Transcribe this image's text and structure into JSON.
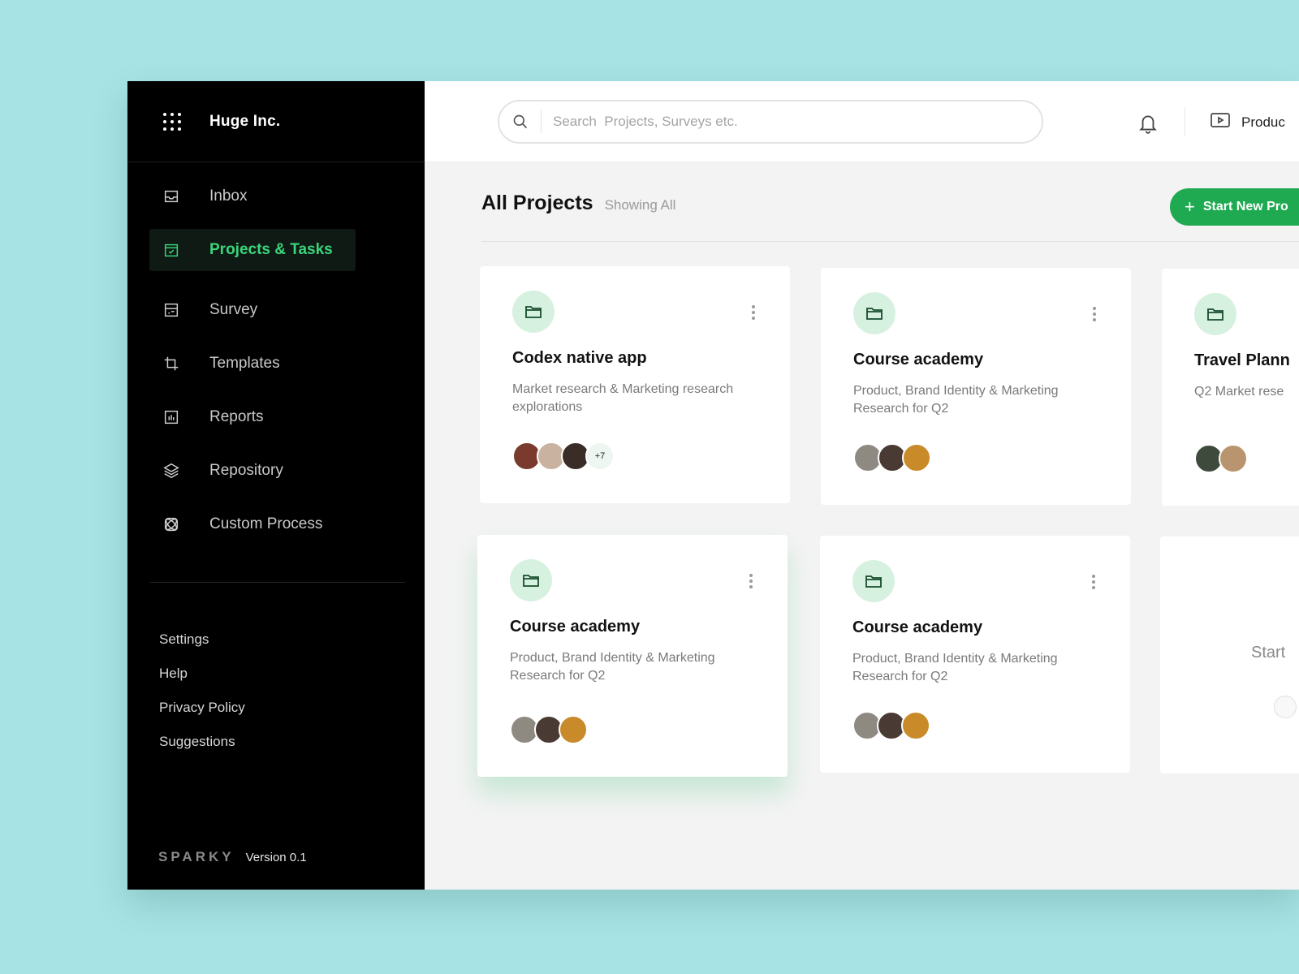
{
  "sidebar": {
    "company": "Huge Inc.",
    "items": [
      {
        "label": "Inbox",
        "icon": "inbox-icon"
      },
      {
        "label": "Projects & Tasks",
        "icon": "calendar-check-icon"
      },
      {
        "label": "Survey",
        "icon": "survey-icon"
      },
      {
        "label": "Templates",
        "icon": "crop-icon"
      },
      {
        "label": "Reports",
        "icon": "bar-chart-icon"
      },
      {
        "label": "Repository",
        "icon": "layers-icon"
      },
      {
        "label": "Custom Process",
        "icon": "atom-icon"
      }
    ],
    "active_index": 1,
    "footer_links": [
      "Settings",
      "Help",
      "Privacy Policy",
      "Suggestions"
    ],
    "brand_logo": "SPARKY",
    "version": "Version 0.1"
  },
  "topbar": {
    "search_placeholder": "Search  Projects, Surveys etc.",
    "product_label": "Produc"
  },
  "main": {
    "title": "All Projects",
    "subtitle": "Showing All",
    "start_button": "Start New Pro",
    "cards": [
      {
        "title": "Codex native app",
        "desc": "Market research & Marketing research\nexplorations",
        "avatars": [
          "#7a3b2e",
          "#c9b3a0",
          "#3a2c26"
        ],
        "more": "+7"
      },
      {
        "title": "Course academy",
        "desc": "Product, Brand Identity & Marketing\nResearch for Q2",
        "avatars": [
          "#8e8a82",
          "#4a3a34",
          "#c98a2a"
        ],
        "more": ""
      },
      {
        "title": "Travel Plann",
        "desc": "Q2 Market rese",
        "avatars": [
          "#3e4a3c",
          "#b8956e"
        ],
        "more": ""
      },
      {
        "title": "Course academy",
        "desc": "Product, Brand Identity & Marketing\nResearch for Q2",
        "avatars": [
          "#8e8a82",
          "#4a3a34",
          "#c98a2a"
        ],
        "more": ""
      },
      {
        "title": "Course academy",
        "desc": "Product, Brand Identity & Marketing\nResearch for Q2",
        "avatars": [
          "#8e8a82",
          "#4a3a34",
          "#c98a2a"
        ],
        "more": ""
      }
    ],
    "ghost_card_text": "Start"
  },
  "colors": {
    "accent": "#1faa51",
    "active_nav": "#3ad57a",
    "folder_bg": "#d7f1e1",
    "page_bg": "#a7e3e4"
  }
}
